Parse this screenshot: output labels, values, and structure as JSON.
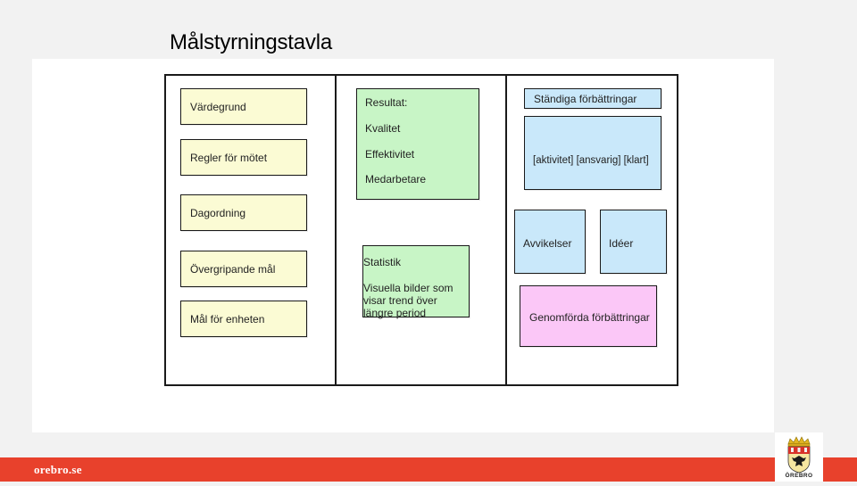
{
  "slide": {
    "title": "Målstyrningstavla"
  },
  "left_column": {
    "cards": [
      "Värdegrund",
      "Regler för mötet",
      "Dagordning",
      "Övergripande mål",
      "Mål för enheten"
    ]
  },
  "middle_column": {
    "result_card": {
      "heading": "Resultat:",
      "items": [
        "Kvalitet",
        "Effektivitet",
        "Medarbetare"
      ]
    },
    "stat_card": {
      "heading": "Statistik",
      "lines": [
        "Visuella bilder som",
        "visar trend över",
        "längre period"
      ]
    }
  },
  "right_column": {
    "improvement_header": "Ständiga förbättringar",
    "improvement_columns": "[aktivitet]  [ansvarig]  [klart]",
    "deviations": "Avvikelser",
    "ideas": "Idéer",
    "completed": "Genomförda förbättringar"
  },
  "footer": {
    "site": "orebro.se",
    "logo_text": "ÖREBRO"
  },
  "colors": {
    "yellow": "#fbfbd4",
    "green": "#c8f5c6",
    "blue": "#c9e8fa",
    "pink": "#fbc7f7",
    "footer": "#e8412c"
  }
}
